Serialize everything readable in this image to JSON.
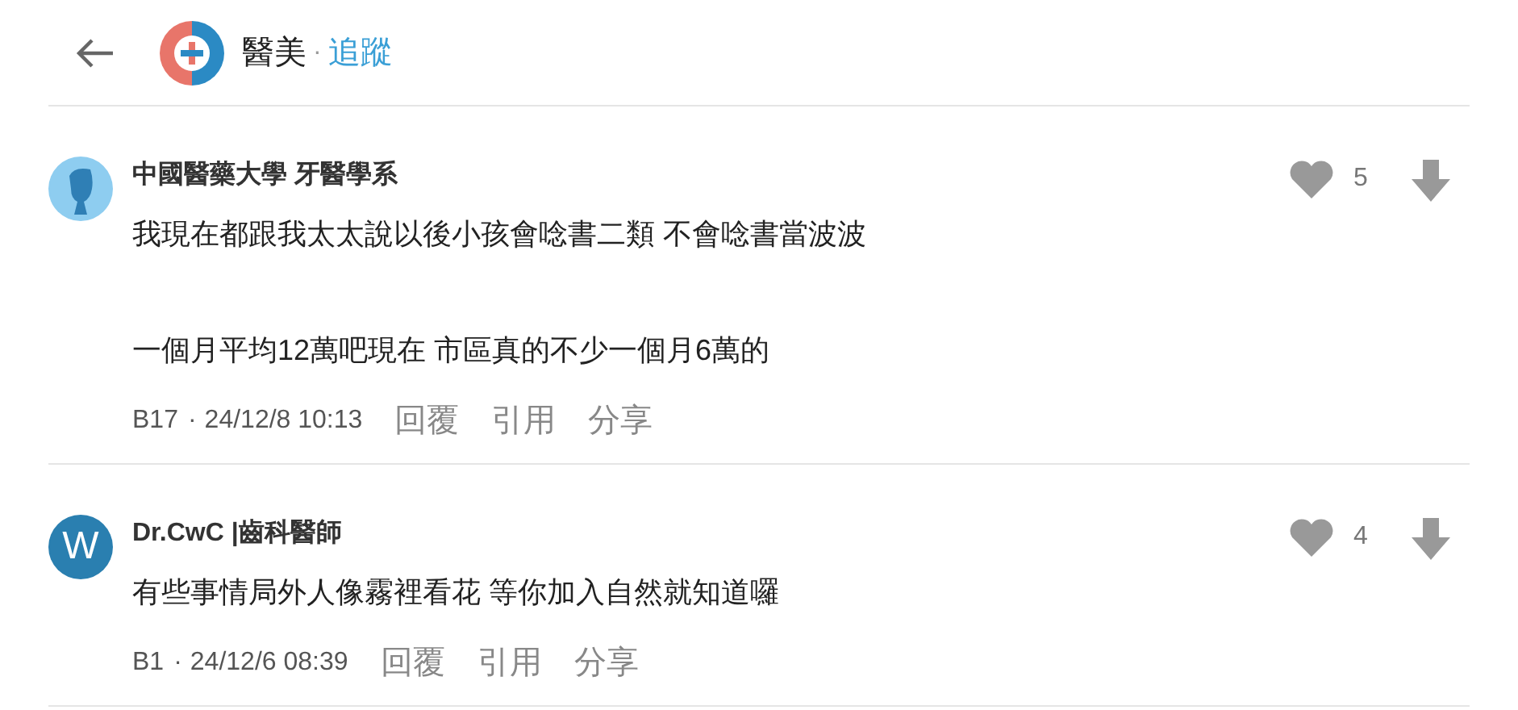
{
  "header": {
    "board": "醫美",
    "separator": "·",
    "action": "追蹤"
  },
  "comments": [
    {
      "author": "中國醫藥大學 牙醫學系",
      "avatar": {
        "kind": "silhouette"
      },
      "paragraphs": [
        "我現在都跟我太太說以後小孩會唸書二類 不會唸書當波波",
        "一個月平均12萬吧現在 市區真的不少一個月6萬的"
      ],
      "floor": "B17",
      "dot": "·",
      "time": "24/12/8 10:13",
      "likes": "5",
      "actions": [
        "回覆",
        "引用",
        "分享"
      ]
    },
    {
      "author": "Dr.CwC |齒科醫師",
      "avatar": {
        "kind": "letter",
        "letter": "W"
      },
      "paragraphs": [
        "有些事情局外人像霧裡看花 等你加入自然就知道囉"
      ],
      "floor": "B1",
      "dot": "·",
      "time": "24/12/6 08:39",
      "likes": "4",
      "actions": [
        "回覆",
        "引用",
        "分享"
      ]
    }
  ]
}
